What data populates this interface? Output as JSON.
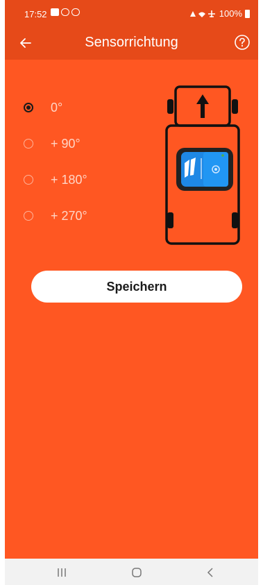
{
  "status_bar": {
    "time": "17:52",
    "battery": "100%"
  },
  "header": {
    "title": "Sensorrichtung"
  },
  "options": [
    {
      "label": "0°",
      "selected": true
    },
    {
      "label": "+ 90°",
      "selected": false
    },
    {
      "label": "+ 180°",
      "selected": false
    },
    {
      "label": "+ 270°",
      "selected": false
    }
  ],
  "save_button": {
    "label": "Speichern"
  },
  "colors": {
    "primary": "#ff5722",
    "header": "#e64a19",
    "sensor": "#1e88e5"
  },
  "icons": {
    "back": "arrow-left-icon",
    "help": "question-circle-icon",
    "car": "car-topview-icon",
    "sensor": "sensor-device-icon",
    "arrow": "arrow-up-icon"
  }
}
